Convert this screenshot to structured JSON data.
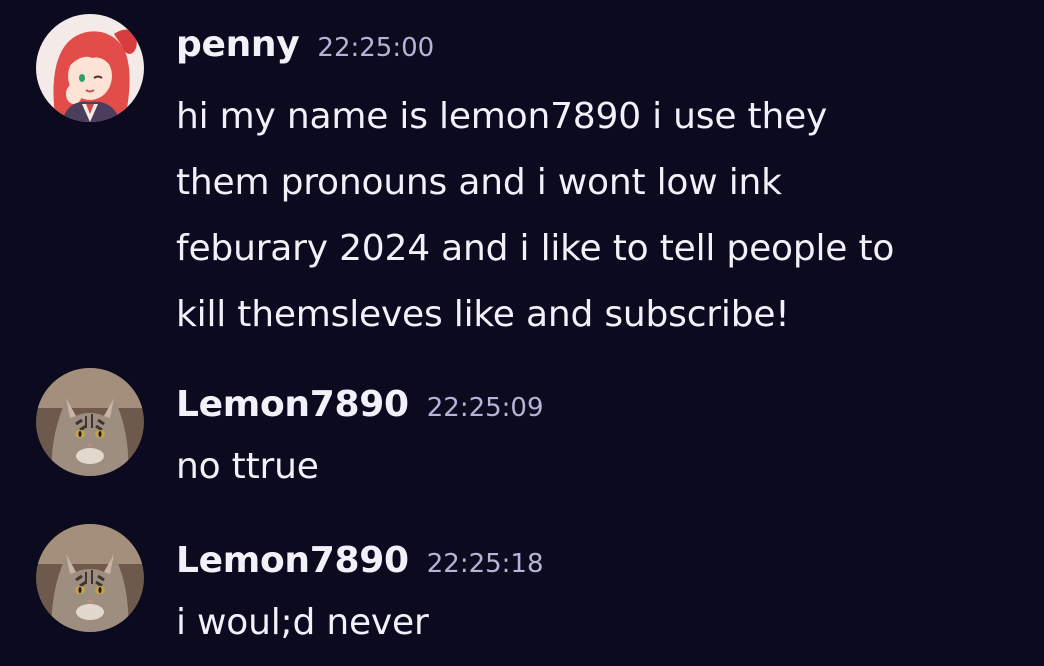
{
  "messages": [
    {
      "username": "penny",
      "timestamp": "22:25:00",
      "avatar_icon": "anime-girl-avatar-icon",
      "lines": [
        "hi my name is lemon7890 i use they",
        "them pronouns and i wont low ink",
        "feburary 2024 and i like to tell people to",
        "kill themsleves like and subscribe!"
      ]
    },
    {
      "username": "Lemon7890",
      "timestamp": "22:25:09",
      "avatar_icon": "cat-avatar-icon",
      "lines": [
        "no ttrue"
      ]
    },
    {
      "username": "Lemon7890",
      "timestamp": "22:25:18",
      "avatar_icon": "cat-avatar-icon",
      "lines": [
        "i woul;d never"
      ]
    }
  ],
  "colors": {
    "background": "#0b0a1f",
    "username": "#f2f0f8",
    "timestamp": "#b7b3d6",
    "text": "#f2f0f8"
  }
}
